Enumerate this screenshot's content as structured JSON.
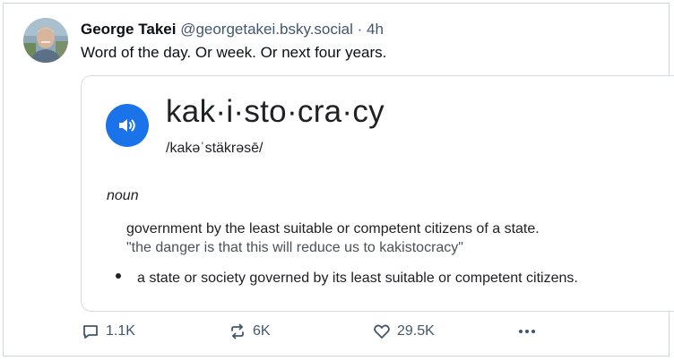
{
  "post": {
    "author_name": "George Takei",
    "author_handle": "@georgetakei.bsky.social",
    "separator": "·",
    "time": "4h",
    "text": "Word of the day. Or week. Or next four years."
  },
  "definition_card": {
    "headword": "kak·i·sto·cra·cy",
    "pronunciation": "/kakəˈstäkrəsē/",
    "part_of_speech": "noun",
    "definition_1": "government by the least suitable or competent citizens of a state.",
    "example_1": "\"the danger is that this will reduce us to kakistocracy\"",
    "definition_2": "a state or society governed by its least suitable or competent citizens."
  },
  "actions": {
    "replies": "1.1K",
    "reposts": "6K",
    "likes": "29.5K"
  },
  "colors": {
    "speaker_button": "#1a73e8",
    "meta_text": "#42576c"
  }
}
